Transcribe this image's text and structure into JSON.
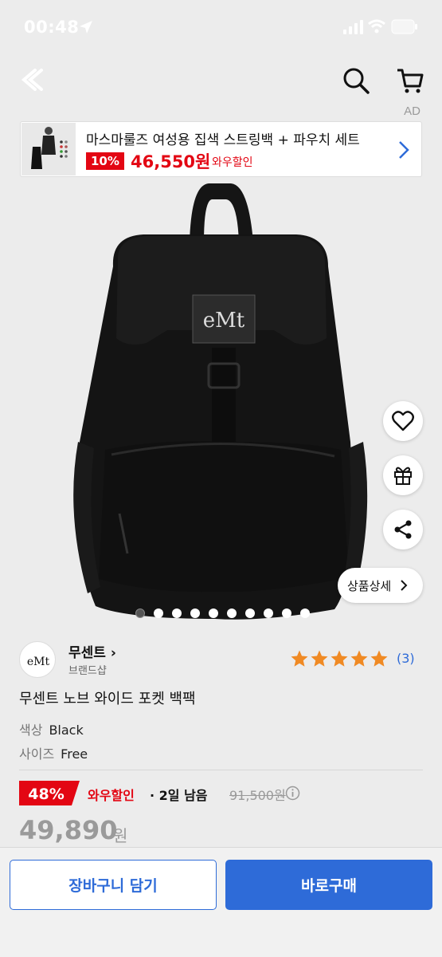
{
  "status": {
    "time": "00:48"
  },
  "ad": {
    "label": "AD",
    "title": "마스마룰즈 여성용 집색 스트링백 + 파우치 세트",
    "discount": "10%",
    "price": "46,550원",
    "wow": "와우할인"
  },
  "gallery": {
    "total": 10,
    "active": 0
  },
  "actions": {
    "detail_label": "상품상세"
  },
  "brand": {
    "name": "무센트",
    "sub": "브랜드샵",
    "logo_text": "eMt"
  },
  "rating": {
    "stars": 5,
    "count": "(3)"
  },
  "product": {
    "title": "무센트 노브 와이드 포켓 백팩",
    "options": [
      {
        "label": "색상",
        "value": "Black"
      },
      {
        "label": "사이즈",
        "value": "Free"
      }
    ]
  },
  "pricing": {
    "discount": "48%",
    "wow": "와우할인",
    "remain": "· 2일 남음",
    "original": "91,500원",
    "price": "49,890",
    "won": "원"
  },
  "buttons": {
    "cart": "장바구니 담기",
    "buy": "바로구매"
  },
  "colors": {
    "accent": "#2e6bd8",
    "sale": "#e30613",
    "star": "#f08a24"
  }
}
